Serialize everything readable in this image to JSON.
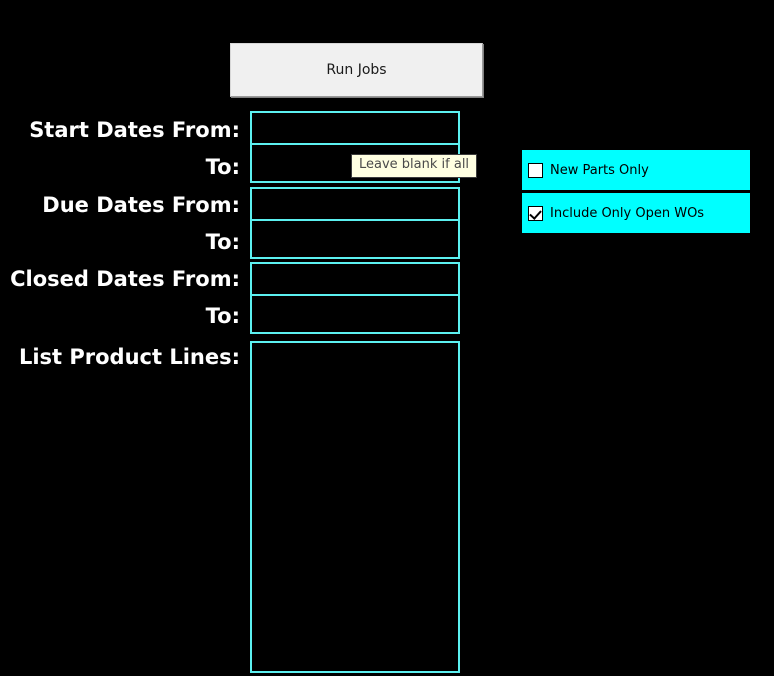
{
  "theme": {
    "background": "#000000",
    "accent_cyan": "#00ffff",
    "field_border": "#5cf0f0",
    "label_color": "#ffffff",
    "button_face": "#f0f0f0",
    "tooltip_background": "#ffffe1"
  },
  "toolbar": {
    "run_jobs_label": "Run Jobs"
  },
  "form": {
    "rows": [
      {
        "label": "Start Dates From:",
        "value": "",
        "placeholder": ""
      },
      {
        "label": "To:",
        "value": "",
        "placeholder": ""
      },
      {
        "label": "Due Dates From:",
        "value": "",
        "placeholder": ""
      },
      {
        "label": "To:",
        "value": "",
        "placeholder": ""
      },
      {
        "label": "Closed Dates From:",
        "value": "",
        "placeholder": ""
      },
      {
        "label": "To:",
        "value": "",
        "placeholder": ""
      },
      {
        "label": "List Product Lines:",
        "value": "",
        "placeholder": ""
      }
    ]
  },
  "tooltip": {
    "text": "Leave blank if all"
  },
  "options": {
    "items": [
      {
        "label": "New Parts Only",
        "checked": false
      },
      {
        "label": "Include Only Open WOs",
        "checked": true
      }
    ]
  }
}
